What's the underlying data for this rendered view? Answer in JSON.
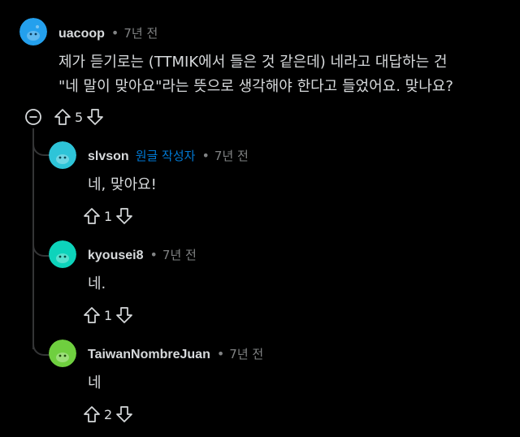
{
  "colors": {
    "background": "#000000",
    "text": "#d7dadc",
    "muted": "#818384",
    "op_badge": "#0079d3",
    "thread_line": "#343536"
  },
  "comments": [
    {
      "author": "uacoop",
      "time": "7년 전",
      "body_lines": [
        "제가 듣기로는 (TTMIK에서 들은 것 같은데) 네라고 대답하는 건",
        "\"네 말이 맞아요\"라는 뜻으로 생각해야 한다고 들었어요. 맞나요?"
      ],
      "votes": "5",
      "avatar_color": "#24a0ed",
      "icons": {
        "collapse": "collapse-minus-icon",
        "upvote": "upvote-arrow-icon",
        "downvote": "downvote-arrow-icon"
      }
    }
  ],
  "replies": [
    {
      "author": "slvson",
      "badge": "원글 작성자",
      "time": "7년 전",
      "body": "네, 맞아요!",
      "votes": "1",
      "avatar_color": "#2ec4d8"
    },
    {
      "author": "kyousei8",
      "time": "7년 전",
      "body": "네.",
      "votes": "1",
      "avatar_color": "#0dd3bb"
    },
    {
      "author": "TaiwanNombreJuan",
      "time": "7년 전",
      "body": "네",
      "votes": "2",
      "avatar_color": "#6fcf3f"
    }
  ]
}
